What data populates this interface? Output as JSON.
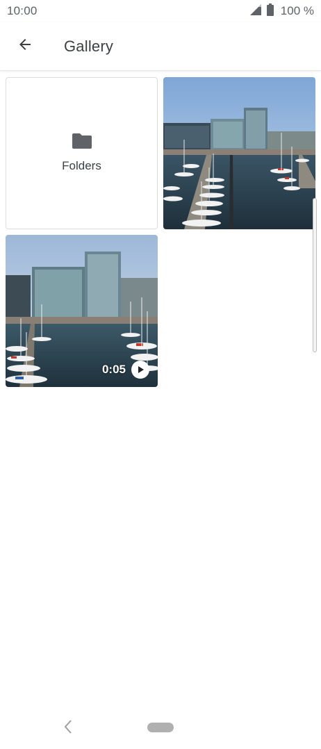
{
  "status_bar": {
    "time": "10:00",
    "battery_percent": "100 %",
    "signal_icon": "signal-icon",
    "battery_icon": "battery-icon"
  },
  "app_bar": {
    "title": "Gallery",
    "back_icon": "arrow-back-icon"
  },
  "grid": {
    "items": [
      {
        "type": "folder",
        "label": "Folders",
        "icon": "folder-icon"
      },
      {
        "type": "photo",
        "description_icon": "harbor-photo"
      },
      {
        "type": "video",
        "duration": "0:05",
        "icon": "play-icon"
      }
    ]
  },
  "nav_bar": {
    "back_icon": "nav-back-icon",
    "home_icon": "home-pill-icon"
  },
  "colors": {
    "text_primary": "#3c4043",
    "status_text": "#5f6368",
    "border": "#dadce0"
  }
}
